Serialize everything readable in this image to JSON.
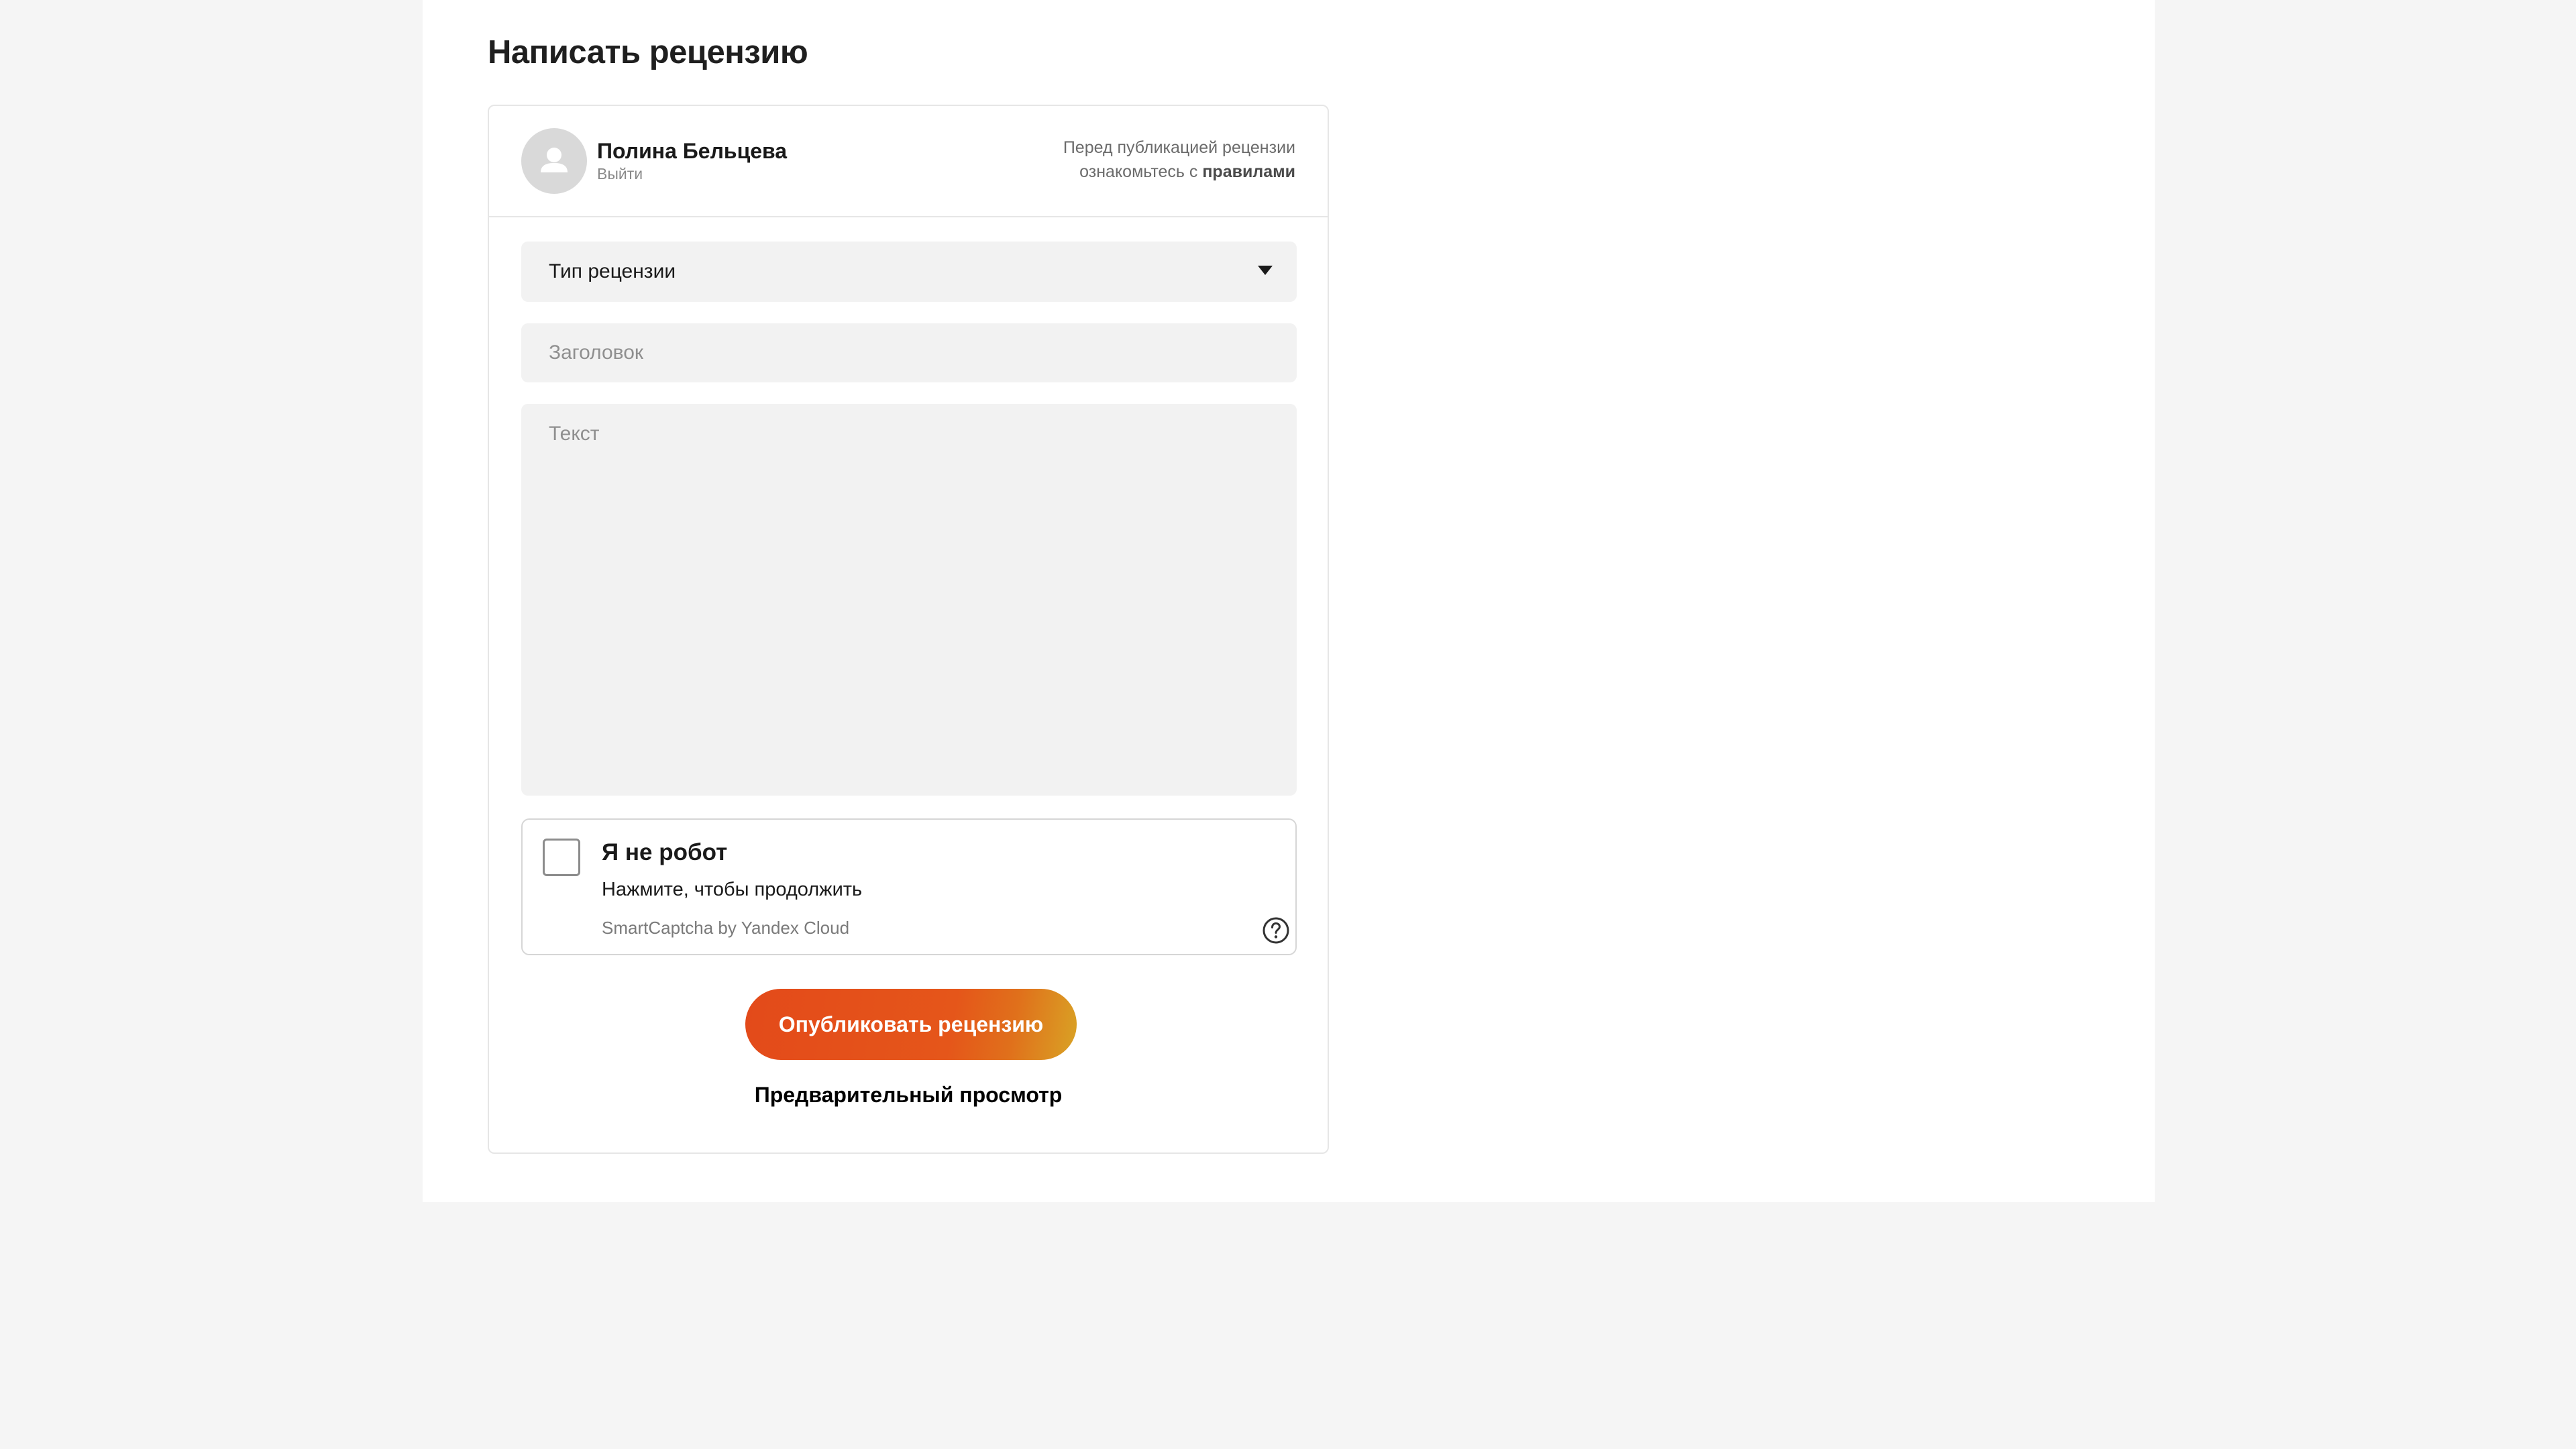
{
  "page": {
    "title": "Написать рецензию"
  },
  "user": {
    "name": "Полина Бельцева",
    "logout_label": "Выйти"
  },
  "rules_note": {
    "line1": "Перед публикацией рецензии",
    "line2_prefix": "ознакомьтесь с ",
    "link_label": "правилами"
  },
  "form": {
    "review_type_label": "Тип рецензии",
    "title_placeholder": "Заголовок",
    "text_placeholder": "Текст"
  },
  "captcha": {
    "title": "Я не робот",
    "subtitle": "Нажмите, чтобы продолжить",
    "brand": "SmartCaptcha by Yandex Cloud",
    "checked": false
  },
  "actions": {
    "publish_label": "Опубликовать рецензию",
    "preview_label": "Предварительный просмотр"
  },
  "colors": {
    "page_background": "#f5f5f5",
    "content_background": "#ffffff",
    "field_background": "#f2f2f2",
    "button_gradient_start": "#e34a1a",
    "button_gradient_end": "#d9a325"
  },
  "icons": {
    "avatar": "user-silhouette-icon",
    "select": "triangle-down-icon",
    "help": "question-circle-icon"
  }
}
